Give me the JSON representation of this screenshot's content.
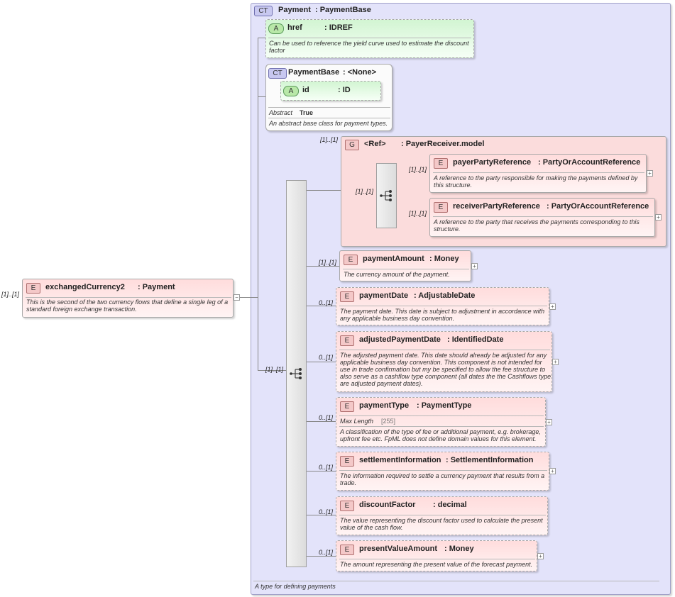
{
  "root": {
    "badge": "E",
    "name": "exchangedCurrency2",
    "type": ": Payment",
    "mult": "[1]..[1]",
    "desc": "This is the second of the two currency flows that define a single leg of a standard foreign exchange transaction."
  },
  "complexType": {
    "badge": "CT",
    "name": "Payment",
    "type": ": PaymentBase",
    "footer": "A type for defining payments"
  },
  "href": {
    "badge": "A",
    "name": "href",
    "type": ": IDREF",
    "desc": "Can be used to reference the yield curve used to estimate the discount factor"
  },
  "paymentBase": {
    "badge": "CT",
    "name": "PaymentBase",
    "type": ": <None>",
    "attrBadge": "A",
    "attrName": "id",
    "attrType": ": ID",
    "abstractLabel": "Abstract",
    "abstractValue": "True",
    "desc": "An abstract base class for payment types."
  },
  "group": {
    "badge": "G",
    "name": "<Ref>",
    "type": ": PayerReceiver.model",
    "mult": "[1]..[1]",
    "seqMult": "[1]..[1]"
  },
  "payer": {
    "badge": "E",
    "name": "payerPartyReference",
    "type": ": PartyOrAccountReference",
    "mult": "[1]..[1]",
    "desc": "A reference to the party responsible for making the payments defined by this structure."
  },
  "receiver": {
    "badge": "E",
    "name": "receiverPartyReference",
    "type": ": PartyOrAccountReference",
    "mult": "[1]..[1]",
    "desc": "A reference to the party that receives the payments corresponding to this structure."
  },
  "mainSeq": {
    "mult": "[1]..[1]"
  },
  "elements": [
    {
      "badge": "E",
      "name": "paymentAmount",
      "type": ": Money",
      "mult": "[1]..[1]",
      "desc": "The currency amount of the payment."
    },
    {
      "badge": "E",
      "name": "paymentDate",
      "type": ": AdjustableDate",
      "mult": "0..[1]",
      "desc": "The payment date. This date is subject to adjustment in accordance with any applicable business day convention."
    },
    {
      "badge": "E",
      "name": "adjustedPaymentDate",
      "type": ": IdentifiedDate",
      "mult": "0..[1]",
      "desc": "The adjusted payment date. This date should already be adjusted for any applicable business day convention. This component is not intended for use in trade confirmation but my be specified to allow the fee structure to also serve as a cashflow type component (all dates the the Cashflows type are adjusted payment dates)."
    },
    {
      "badge": "E",
      "name": "paymentType",
      "type": ": PaymentType",
      "mult": "0..[1]",
      "facetLabel": "Max Length",
      "facetValue": "[255]",
      "desc": "A classification of the type of fee or additional payment, e.g. brokerage, upfront fee etc. FpML does not define domain values for this element."
    },
    {
      "badge": "E",
      "name": "settlementInformation",
      "type": ": SettlementInformation",
      "mult": "0..[1]",
      "desc": "The information required to settle a currency payment that results from a trade."
    },
    {
      "badge": "E",
      "name": "discountFactor",
      "type": ": decimal",
      "mult": "0..[1]",
      "desc": "The value representing the discount factor used to calculate the present value of the cash flow."
    },
    {
      "badge": "E",
      "name": "presentValueAmount",
      "type": ": Money",
      "mult": "0..[1]",
      "desc": "The amount representing the present value of the forecast payment."
    }
  ],
  "icons": {
    "expand": "+",
    "collapse": "−"
  }
}
